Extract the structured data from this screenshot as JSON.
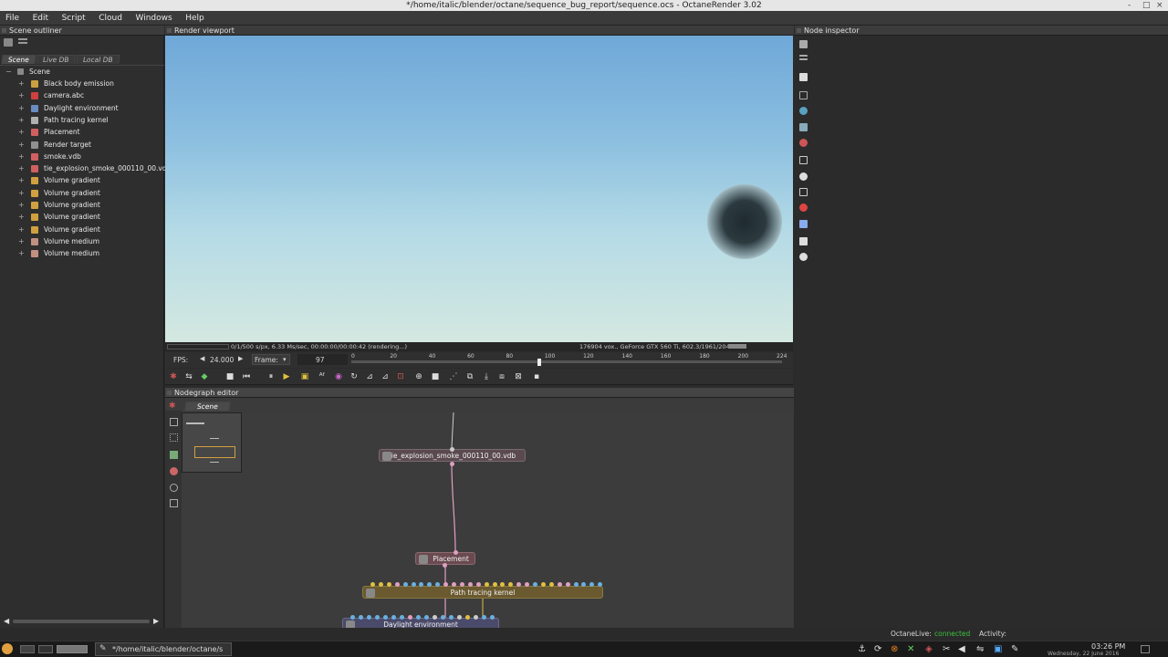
{
  "window": {
    "title": "*/home/italic/blender/octane/sequence_bug_report/sequence.ocs - OctaneRender 3.02",
    "controls": [
      "-",
      "□",
      "×"
    ]
  },
  "menu": [
    "File",
    "Edit",
    "Script",
    "Cloud",
    "Windows",
    "Help"
  ],
  "outliner": {
    "title": "Scene outliner",
    "tabs": [
      "Scene",
      "Live DB",
      "Local DB"
    ],
    "root": "Scene",
    "items": [
      {
        "label": "Black body emission",
        "icon": "emission-icon",
        "color": "#c9a040"
      },
      {
        "label": "camera.abc",
        "icon": "camera-icon",
        "color": "#d04040"
      },
      {
        "label": "Daylight environment",
        "icon": "environment-icon",
        "color": "#6a8cc0"
      },
      {
        "label": "Path tracing kernel",
        "icon": "kernel-icon",
        "color": "#b0b0b0"
      },
      {
        "label": "Placement",
        "icon": "placement-icon",
        "color": "#d06060"
      },
      {
        "label": "Render target",
        "icon": "render-target-icon",
        "color": "#909090"
      },
      {
        "label": "smoke.vdb",
        "icon": "volume-icon",
        "color": "#d06060"
      },
      {
        "label": "tie_explosion_smoke_000110_00.vdb",
        "icon": "volume-icon",
        "color": "#d06060"
      },
      {
        "label": "Volume gradient",
        "icon": "gradient-icon",
        "color": "#d0a040"
      },
      {
        "label": "Volume gradient",
        "icon": "gradient-icon",
        "color": "#d0a040"
      },
      {
        "label": "Volume gradient",
        "icon": "gradient-icon",
        "color": "#d0a040"
      },
      {
        "label": "Volume gradient",
        "icon": "gradient-icon",
        "color": "#d0a040"
      },
      {
        "label": "Volume gradient",
        "icon": "gradient-icon",
        "color": "#d0a040"
      },
      {
        "label": "Volume medium",
        "icon": "medium-icon",
        "color": "#c09080"
      },
      {
        "label": "Volume medium",
        "icon": "medium-icon",
        "color": "#c09080"
      }
    ]
  },
  "viewport": {
    "title": "Render viewport",
    "status_left": "0/1/500 s/px, 6.33 Ms/sec, 00:00:00/00:00:42 (rendering...)",
    "status_right": "176904 vox., GeForce GTX 560 Ti, 602.3/1961/2047 MB",
    "fps_label": "FPS:",
    "fps_value": "24.000",
    "frame_label": "Frame:",
    "frame_value": "97",
    "ticks": [
      "0",
      "20",
      "40",
      "60",
      "80",
      "100",
      "120",
      "140",
      "160",
      "180",
      "200",
      "224"
    ],
    "playhead_fraction": 0.433
  },
  "nodegraph": {
    "title": "Nodegraph editor",
    "tab": "Scene",
    "nodes": {
      "vdb": "tie_explosion_smoke_000110_00.vdb",
      "placement": "Placement",
      "kernel": "Path tracing kernel",
      "daylight": "Daylight environment"
    }
  },
  "inspector": {
    "title": "Node inspector"
  },
  "bottom": {
    "live_label": "OctaneLive:",
    "live_status": "connected",
    "activity_label": "Activity:"
  },
  "taskbar": {
    "task": "*/home/italic/blender/octane/s",
    "time": "03:26 PM",
    "date": "Wednesday, 22 June 2016"
  },
  "colors": {
    "connected": "#3cc03c",
    "kernel_node": "#6b5a30",
    "placement_node": "#6a4a50",
    "vdb_node": "#5a4a50",
    "daylight_node": "#4a4a6a"
  }
}
